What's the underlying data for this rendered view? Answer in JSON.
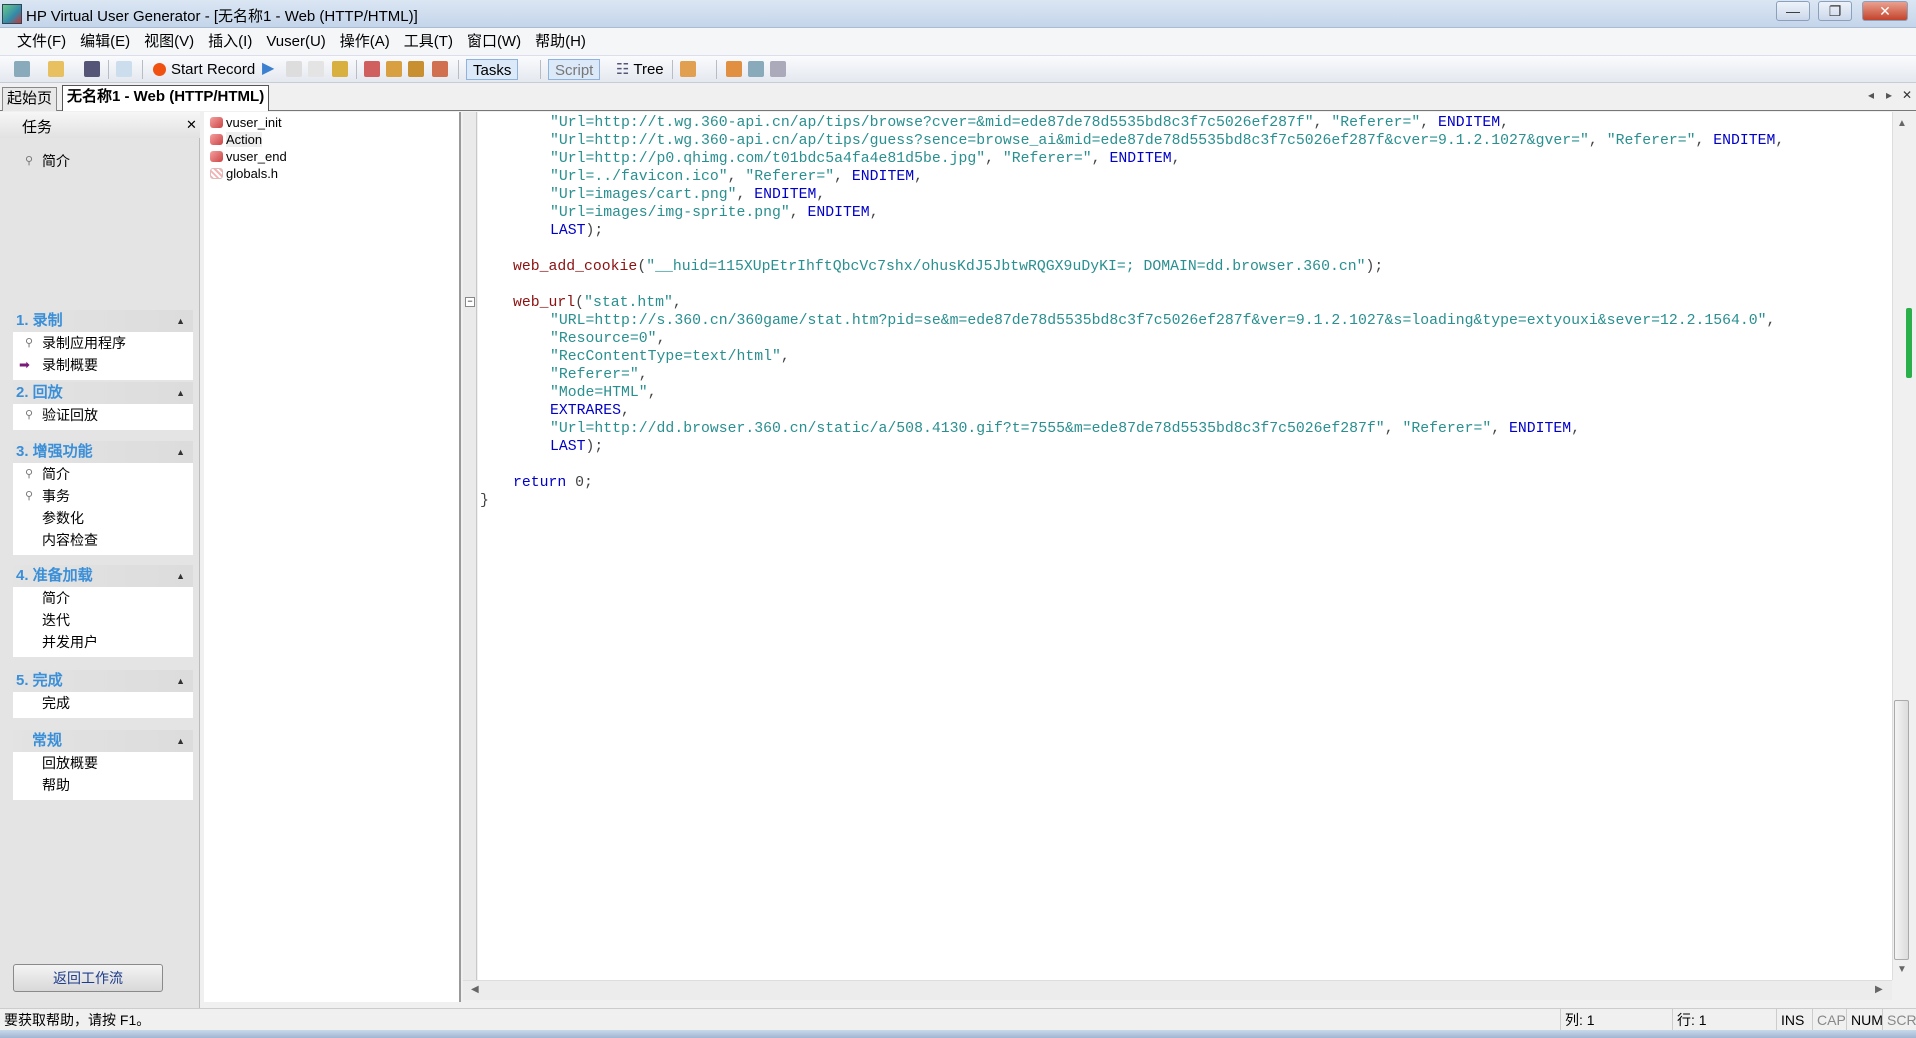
{
  "window": {
    "title": "HP Virtual User Generator - [无名称1 - Web (HTTP/HTML)]",
    "minimize": "—",
    "maximize": "❐",
    "close": "✕"
  },
  "menu": [
    "文件(F)",
    "编辑(E)",
    "视图(V)",
    "插入(I)",
    "Vuser(U)",
    "操作(A)",
    "工具(T)",
    "窗口(W)",
    "帮助(H)"
  ],
  "toolbar": {
    "start_record": "Start Record",
    "tasks": "Tasks",
    "script": "Script",
    "tree": "Tree"
  },
  "tabs": [
    "起始页",
    "无名称1 - Web (HTTP/HTML)"
  ],
  "tab_nav": {
    "prev": "◂",
    "next": "▸",
    "close": "✕"
  },
  "task_pane": {
    "title": "任务",
    "close": "✕",
    "intro": "简介",
    "groups": [
      {
        "title": "1. 录制",
        "items": [
          "录制应用程序",
          "录制概要"
        ]
      },
      {
        "title": "2. 回放",
        "items": [
          "验证回放"
        ]
      },
      {
        "title": "3. 增强功能",
        "items": [
          "简介",
          "事务",
          "参数化",
          "内容检查"
        ]
      },
      {
        "title": "4. 准备加载",
        "items": [
          "简介",
          "迭代",
          "并发用户"
        ]
      },
      {
        "title": "5. 完成",
        "items": [
          "完成"
        ]
      },
      {
        "title": "常规",
        "items": [
          "回放概要",
          "帮助"
        ]
      }
    ],
    "return_button": "返回工作流"
  },
  "tree": [
    "vuser_init",
    "Action",
    "vuser_end",
    "globals.h"
  ],
  "code": [
    {
      "i": 2,
      "t": [
        [
          "s",
          "\"Url=http://t.wg.360-api.cn/ap/tips/browse?cver=&mid=ede87de78d5535bd8c3f7c5026ef287f\""
        ],
        [
          "p",
          ", "
        ],
        [
          "s",
          "\"Referer=\""
        ],
        [
          "p",
          ", "
        ],
        [
          "k",
          "ENDITEM"
        ],
        [
          "p",
          ","
        ]
      ]
    },
    {
      "i": 2,
      "t": [
        [
          "s",
          "\"Url=http://t.wg.360-api.cn/ap/tips/guess?sence=browse_ai&mid=ede87de78d5535bd8c3f7c5026ef287f&cver=9.1.2.1027&gver=\""
        ],
        [
          "p",
          ", "
        ],
        [
          "s",
          "\"Referer=\""
        ],
        [
          "p",
          ", "
        ],
        [
          "k",
          "ENDITEM"
        ],
        [
          "p",
          ","
        ]
      ]
    },
    {
      "i": 2,
      "t": [
        [
          "s",
          "\"Url=http://p0.qhimg.com/t01bdc5a4fa4e81d5be.jpg\""
        ],
        [
          "p",
          ", "
        ],
        [
          "s",
          "\"Referer=\""
        ],
        [
          "p",
          ", "
        ],
        [
          "k",
          "ENDITEM"
        ],
        [
          "p",
          ","
        ]
      ]
    },
    {
      "i": 2,
      "t": [
        [
          "s",
          "\"Url=../favicon.ico\""
        ],
        [
          "p",
          ", "
        ],
        [
          "s",
          "\"Referer=\""
        ],
        [
          "p",
          ", "
        ],
        [
          "k",
          "ENDITEM"
        ],
        [
          "p",
          ","
        ]
      ]
    },
    {
      "i": 2,
      "t": [
        [
          "s",
          "\"Url=images/cart.png\""
        ],
        [
          "p",
          ", "
        ],
        [
          "k",
          "ENDITEM"
        ],
        [
          "p",
          ","
        ]
      ]
    },
    {
      "i": 2,
      "t": [
        [
          "s",
          "\"Url=images/img-sprite.png\""
        ],
        [
          "p",
          ", "
        ],
        [
          "k",
          "ENDITEM"
        ],
        [
          "p",
          ","
        ]
      ]
    },
    {
      "i": 2,
      "t": [
        [
          "k",
          "LAST"
        ],
        [
          "p",
          ");"
        ]
      ]
    },
    {
      "i": 0,
      "t": []
    },
    {
      "i": 1,
      "t": [
        [
          "f",
          "web_add_cookie"
        ],
        [
          "p",
          "("
        ],
        [
          "s",
          "\"__huid=115XUpEtrIhftQbcVc7shx/ohusKdJ5JbtwRQGX9uDyKI=; DOMAIN=dd.browser.360.cn\""
        ],
        [
          "p",
          ");"
        ]
      ]
    },
    {
      "i": 0,
      "t": []
    },
    {
      "i": 1,
      "t": [
        [
          "f",
          "web_url"
        ],
        [
          "p",
          "("
        ],
        [
          "s",
          "\"stat.htm\""
        ],
        [
          "p",
          ","
        ]
      ]
    },
    {
      "i": 2,
      "t": [
        [
          "s",
          "\"URL=http://s.360.cn/360game/stat.htm?pid=se&m=ede87de78d5535bd8c3f7c5026ef287f&ver=9.1.2.1027&s=loading&type=extyouxi&sever=12.2.1564.0\""
        ],
        [
          "p",
          ","
        ]
      ]
    },
    {
      "i": 2,
      "t": [
        [
          "s",
          "\"Resource=0\""
        ],
        [
          "p",
          ","
        ]
      ]
    },
    {
      "i": 2,
      "t": [
        [
          "s",
          "\"RecContentType=text/html\""
        ],
        [
          "p",
          ","
        ]
      ]
    },
    {
      "i": 2,
      "t": [
        [
          "s",
          "\"Referer=\""
        ],
        [
          "p",
          ","
        ]
      ]
    },
    {
      "i": 2,
      "t": [
        [
          "s",
          "\"Mode=HTML\""
        ],
        [
          "p",
          ","
        ]
      ]
    },
    {
      "i": 2,
      "t": [
        [
          "k",
          "EXTRARES"
        ],
        [
          "p",
          ","
        ]
      ]
    },
    {
      "i": 2,
      "t": [
        [
          "s",
          "\"Url=http://dd.browser.360.cn/static/a/508.4130.gif?t=7555&m=ede87de78d5535bd8c3f7c5026ef287f\""
        ],
        [
          "p",
          ", "
        ],
        [
          "s",
          "\"Referer=\""
        ],
        [
          "p",
          ", "
        ],
        [
          "k",
          "ENDITEM"
        ],
        [
          "p",
          ","
        ]
      ]
    },
    {
      "i": 2,
      "t": [
        [
          "k",
          "LAST"
        ],
        [
          "p",
          ");"
        ]
      ]
    },
    {
      "i": 0,
      "t": []
    },
    {
      "i": 1,
      "t": [
        [
          "k",
          "return"
        ],
        [
          "p",
          " 0;"
        ]
      ]
    },
    {
      "i": 0,
      "t": [
        [
          "p",
          "}"
        ]
      ]
    }
  ],
  "status": {
    "help": "要获取帮助，请按 F1。",
    "col": "列: 1",
    "row": "行: 1",
    "ins": "INS",
    "cap": "CAP",
    "num": "NUM",
    "scrl": "SCRL"
  },
  "colors": {
    "string": "#2a8f8f",
    "keyword": "#0000c8",
    "function": "#8b1010",
    "group_title": "#3a8fd8"
  }
}
